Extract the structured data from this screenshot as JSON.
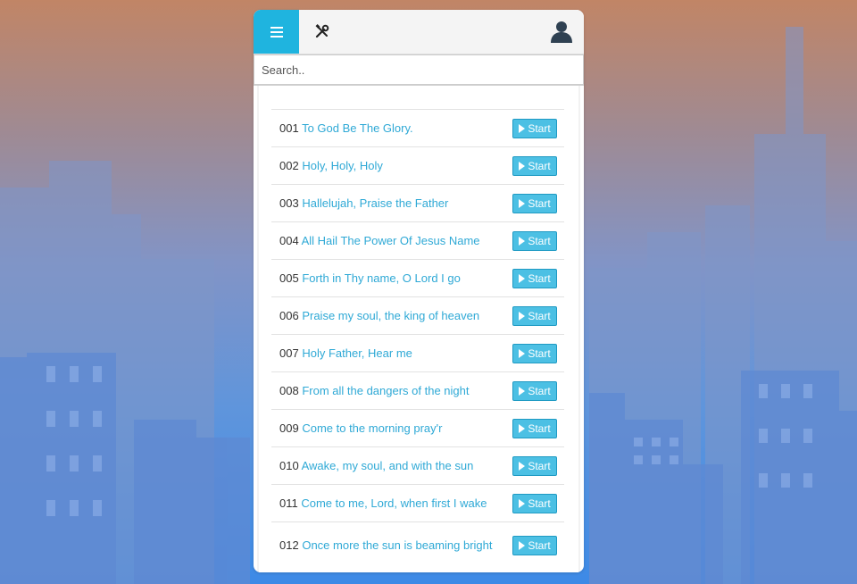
{
  "search": {
    "placeholder": "Search.."
  },
  "colors": {
    "accent": "#1fb4df",
    "link": "#2fa9d6",
    "button": "#4cc0e4"
  },
  "icons": {
    "menu": "hamburger-icon",
    "tools": "tools-icon",
    "user": "user-icon",
    "play": "play-icon"
  },
  "hymns": [
    {
      "number": "001",
      "title": "To God Be The Glory.",
      "button": "Start"
    },
    {
      "number": "002",
      "title": "Holy, Holy, Holy",
      "button": "Start"
    },
    {
      "number": "003",
      "title": "Hallelujah, Praise the Father",
      "button": "Start"
    },
    {
      "number": "004",
      "title": "All Hail The Power Of Jesus Name",
      "button": "Start"
    },
    {
      "number": "005",
      "title": "Forth in Thy name, O Lord I go",
      "button": "Start"
    },
    {
      "number": "006",
      "title": "Praise my soul, the king of heaven",
      "button": "Start"
    },
    {
      "number": "007",
      "title": "Holy Father, Hear me",
      "button": "Start"
    },
    {
      "number": "008",
      "title": "From all the dangers of the night",
      "button": "Start"
    },
    {
      "number": "009",
      "title": "Come to the morning pray'r",
      "button": "Start"
    },
    {
      "number": "010",
      "title": "Awake, my soul, and with the sun",
      "button": "Start"
    },
    {
      "number": "011",
      "title": "Come to me, Lord, when first I wake",
      "button": "Start"
    },
    {
      "number": "012",
      "title": "Once more the sun is beaming bright",
      "button": "Start"
    }
  ]
}
